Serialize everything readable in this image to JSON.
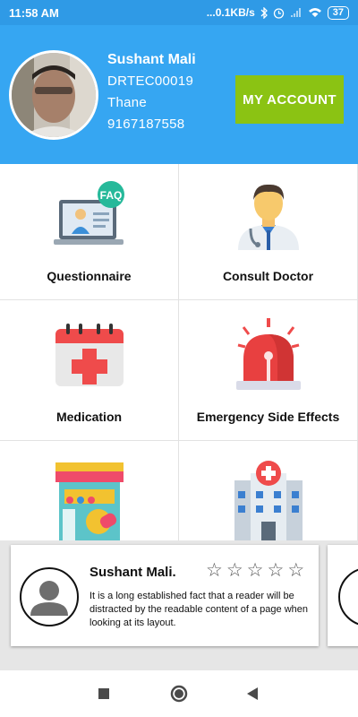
{
  "status_bar": {
    "time": "11:58 AM",
    "network_speed": "...0.1KB/s",
    "battery": "37",
    "icons": [
      "bluetooth-icon",
      "alarm-icon",
      "signal-icon",
      "wifi-icon",
      "battery-icon"
    ]
  },
  "profile": {
    "name": "Sushant Mali",
    "code": "DRTEC00019",
    "city": "Thane",
    "phone": "9167187558",
    "account_button": "MY ACCOUNT"
  },
  "menu": [
    {
      "label": "Questionnaire",
      "icon": "faq-laptop-icon"
    },
    {
      "label": "Consult Doctor",
      "icon": "doctor-icon"
    },
    {
      "label": "Medication",
      "icon": "calendar-medical-icon"
    },
    {
      "label": "Emergency Side Effects",
      "icon": "emergency-siren-icon"
    },
    {
      "label": "",
      "icon": "pharmacy-store-icon"
    },
    {
      "label": "",
      "icon": "hospital-icon"
    }
  ],
  "review": {
    "name": "Sushant Mali.",
    "rating": 0,
    "max_rating": 5,
    "text": "It is a long established fact that a reader will be distracted by the readable content of a page when looking at its layout."
  },
  "colors": {
    "header": "#36a6f2",
    "status_bar": "#2f9ae6",
    "account_button": "#8bc313"
  },
  "nav": [
    "recent-apps-icon",
    "home-icon",
    "back-icon"
  ]
}
